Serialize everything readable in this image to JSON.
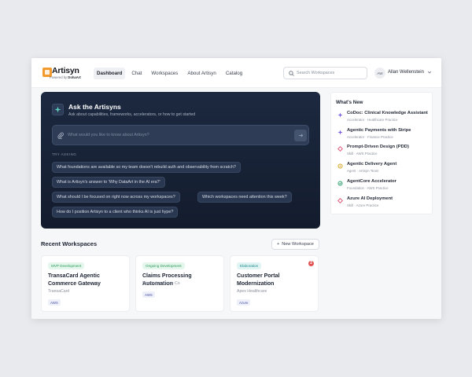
{
  "brand": {
    "name": "Artisyn",
    "powered_prefix": "Powered by",
    "powered_by": "DohaArt",
    "logo_icon": "orange-square-logo-icon"
  },
  "nav": {
    "items": [
      {
        "label": "Dashboard",
        "active": true
      },
      {
        "label": "Chat",
        "active": false
      },
      {
        "label": "Workspaces",
        "active": false
      },
      {
        "label": "About Artisyn",
        "active": false
      },
      {
        "label": "Catalog",
        "active": false
      }
    ]
  },
  "search": {
    "placeholder": "Search Workspaces",
    "value": ""
  },
  "user": {
    "initials": "AW",
    "name": "Allan Wellenstein"
  },
  "ask": {
    "title": "Ask the Artisyns",
    "subtitle": "Ask about capabilities, frameworks, accelerators, or how to get started",
    "placeholder": "What would you like to know about Artisyn?",
    "value": "",
    "try_label": "TRY ASKING",
    "suggestions": [
      "What foundations are available so my team doesn't rebuild auth and observability from scratch?",
      "What is Artisyn's answer to 'Why DataArt in the AI era?'",
      "What should I be focused on right now across my workspaces?",
      "Which workspaces need attention this week?",
      "How do I position Artisyn to a client who thinks AI is just hype?"
    ]
  },
  "whats_new": {
    "title": "What's New",
    "items": [
      {
        "name": "CoDoc: Clinical Knowledge Assistant",
        "meta": "Accelerator · Healthcare Practice",
        "icon": "sparkle-icon",
        "color": "#7a5ce0"
      },
      {
        "name": "Agentic Payments with Stripe",
        "meta": "Accelerator · Finance Practice",
        "icon": "sparkle-icon",
        "color": "#7a5ce0"
      },
      {
        "name": "Prompt-Driven Design (PDD)",
        "meta": "Skill · AWS Practice",
        "icon": "diamond-icon",
        "color": "#e0577a"
      },
      {
        "name": "Agentic Delivery Agent",
        "meta": "Agent · Artisyn Team",
        "icon": "bot-icon",
        "color": "#d6a21e"
      },
      {
        "name": "AgentCore Accelerator",
        "meta": "Foundation · AWS Practice",
        "icon": "layers-icon",
        "color": "#2aa06a"
      },
      {
        "name": "Azure AI Deployment",
        "meta": "Skill · Azure Practice",
        "icon": "diamond-icon",
        "color": "#e0577a"
      }
    ]
  },
  "recent": {
    "title": "Recent Workspaces",
    "new_button": "New Workspace",
    "alert_count": "2",
    "cards": [
      {
        "status": "MVP Development",
        "status_color": "green",
        "title": "TransaCard Agentic Commerce Gateway",
        "client": "TransaCard",
        "tag": "AWS"
      },
      {
        "status": "Ongoing Development",
        "status_color": "green",
        "title": "Claims Processing Automation",
        "client": "Pacific Insurance Co",
        "tag": "AWS"
      },
      {
        "status": "Elaboration",
        "status_color": "teal",
        "title": "Customer Portal Modernization",
        "client": "Apex Healthcare",
        "tag": "Azure"
      }
    ]
  }
}
